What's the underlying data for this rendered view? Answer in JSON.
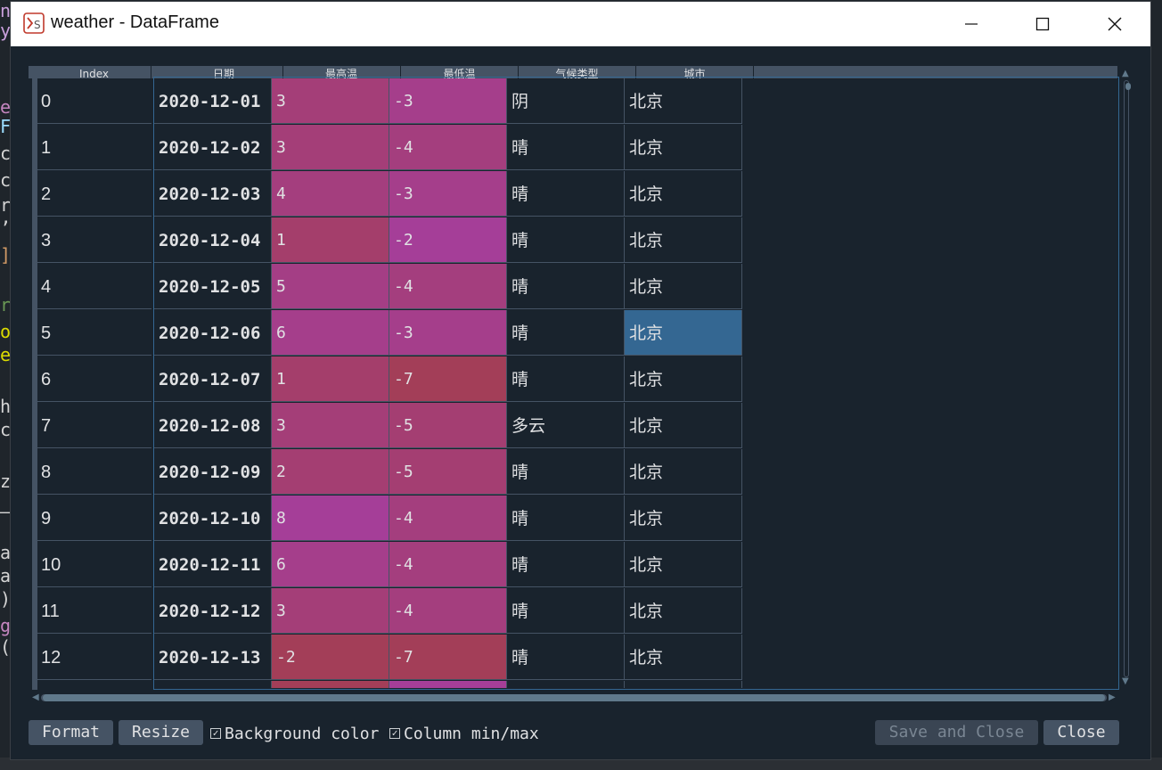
{
  "window": {
    "title": "weather - DataFrame"
  },
  "background_editor": {
    "glyphs": [
      "n",
      "y",
      "e",
      "F",
      "c",
      "c",
      "r",
      "’",
      "].",
      "r",
      "or",
      "e",
      "h",
      "c",
      "z",
      "—",
      "a",
      "a",
      ")",
      "g",
      "("
    ]
  },
  "table": {
    "index_header": "Index",
    "columns": [
      "日期",
      "最高温",
      "最低温",
      "气候类型",
      "城市"
    ],
    "rows": [
      {
        "index": "0",
        "date": "2020-12-01",
        "high": "3",
        "low": "-3",
        "type": "阴",
        "city": "北京"
      },
      {
        "index": "1",
        "date": "2020-12-02",
        "high": "3",
        "low": "-4",
        "type": "晴",
        "city": "北京"
      },
      {
        "index": "2",
        "date": "2020-12-03",
        "high": "4",
        "low": "-3",
        "type": "晴",
        "city": "北京"
      },
      {
        "index": "3",
        "date": "2020-12-04",
        "high": "1",
        "low": "-2",
        "type": "晴",
        "city": "北京"
      },
      {
        "index": "4",
        "date": "2020-12-05",
        "high": "5",
        "low": "-4",
        "type": "晴",
        "city": "北京"
      },
      {
        "index": "5",
        "date": "2020-12-06",
        "high": "6",
        "low": "-3",
        "type": "晴",
        "city": "北京"
      },
      {
        "index": "6",
        "date": "2020-12-07",
        "high": "1",
        "low": "-7",
        "type": "晴",
        "city": "北京"
      },
      {
        "index": "7",
        "date": "2020-12-08",
        "high": "3",
        "low": "-5",
        "type": "多云",
        "city": "北京"
      },
      {
        "index": "8",
        "date": "2020-12-09",
        "high": "2",
        "low": "-5",
        "type": "晴",
        "city": "北京"
      },
      {
        "index": "9",
        "date": "2020-12-10",
        "high": "8",
        "low": "-4",
        "type": "晴",
        "city": "北京"
      },
      {
        "index": "10",
        "date": "2020-12-11",
        "high": "6",
        "low": "-4",
        "type": "晴",
        "city": "北京"
      },
      {
        "index": "11",
        "date": "2020-12-12",
        "high": "3",
        "low": "-4",
        "type": "晴",
        "city": "北京"
      },
      {
        "index": "12",
        "date": "2020-12-13",
        "high": "-2",
        "low": "-7",
        "type": "晴",
        "city": "北京"
      }
    ],
    "selected_cell": {
      "row": 5,
      "column": "城市"
    },
    "numeric_ranges": {
      "high": [
        -2,
        8
      ],
      "low": [
        -7,
        -2
      ]
    },
    "colors": {
      "cold": "#a33e58",
      "warm": "#a53e98",
      "selected": "#346792"
    }
  },
  "footer": {
    "format_label": "Format",
    "resize_label": "Resize",
    "background_color_label": "Background color",
    "background_color_checked": true,
    "column_minmax_label": "Column min/max",
    "column_minmax_checked": true,
    "save_close_label": "Save and Close",
    "close_label": "Close"
  }
}
